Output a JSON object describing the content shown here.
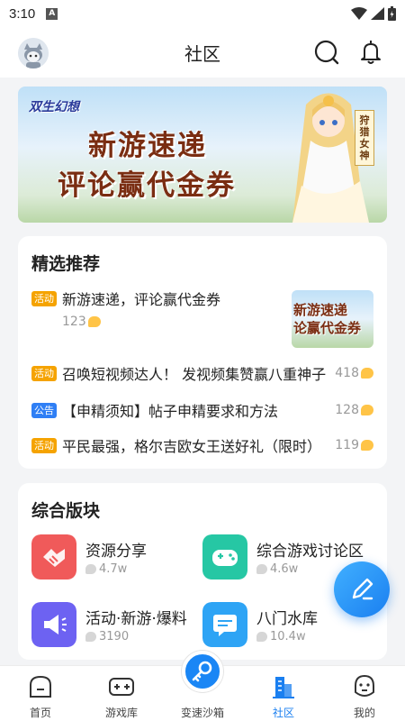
{
  "status_bar": {
    "time": "3:10",
    "notif_letter": "A"
  },
  "header": {
    "title": "社区"
  },
  "banner": {
    "logo": "双生幻想",
    "line1": "新游速递",
    "line2": "评论赢代金券",
    "tag": "狩猎女神"
  },
  "featured": {
    "title": "精选推荐",
    "top_item": {
      "badge": "活动",
      "text": "新游速递，评论赢代金券",
      "count": "123",
      "thumb_line1": "新游速递",
      "thumb_line2": "论赢代金券"
    },
    "items": [
      {
        "badge": "活动",
        "badge_type": "activity",
        "text": "召唤短视频达人！ 发视频集赞赢八重神子",
        "count": "418"
      },
      {
        "badge": "公告",
        "badge_type": "notice",
        "text": "【申精须知】帖子申精要求和方法",
        "count": "128"
      },
      {
        "badge": "活动",
        "badge_type": "activity",
        "text": "平民最强，格尔吉欧女王送好礼（限时）",
        "count": "119"
      }
    ]
  },
  "boards": {
    "title": "综合版块",
    "items": [
      {
        "name": "资源分享",
        "count": "4.7w",
        "color": "#f05a5a",
        "icon": "handshake-icon"
      },
      {
        "name": "综合游戏讨论区",
        "count": "4.6w",
        "color": "#26c7a4",
        "icon": "gamepad-icon"
      },
      {
        "name": "活动·新游·爆料",
        "count": "3190",
        "color": "#6d62f2",
        "icon": "megaphone-icon"
      },
      {
        "name": "八门水库",
        "count": "10.4w",
        "color": "#2ea4f5",
        "icon": "chat-icon"
      }
    ]
  },
  "bottom_nav": {
    "items": [
      {
        "label": "首页",
        "icon": "home-icon"
      },
      {
        "label": "游戏库",
        "icon": "gamepad-icon"
      },
      {
        "label": "变速沙箱",
        "icon": "key-icon"
      },
      {
        "label": "社区",
        "icon": "community-icon",
        "active": true
      },
      {
        "label": "我的",
        "icon": "profile-icon"
      }
    ]
  },
  "colors": {
    "accent": "#1a7ff0",
    "activity_badge": "#f5a300",
    "notice_badge": "#2f7ff5"
  }
}
